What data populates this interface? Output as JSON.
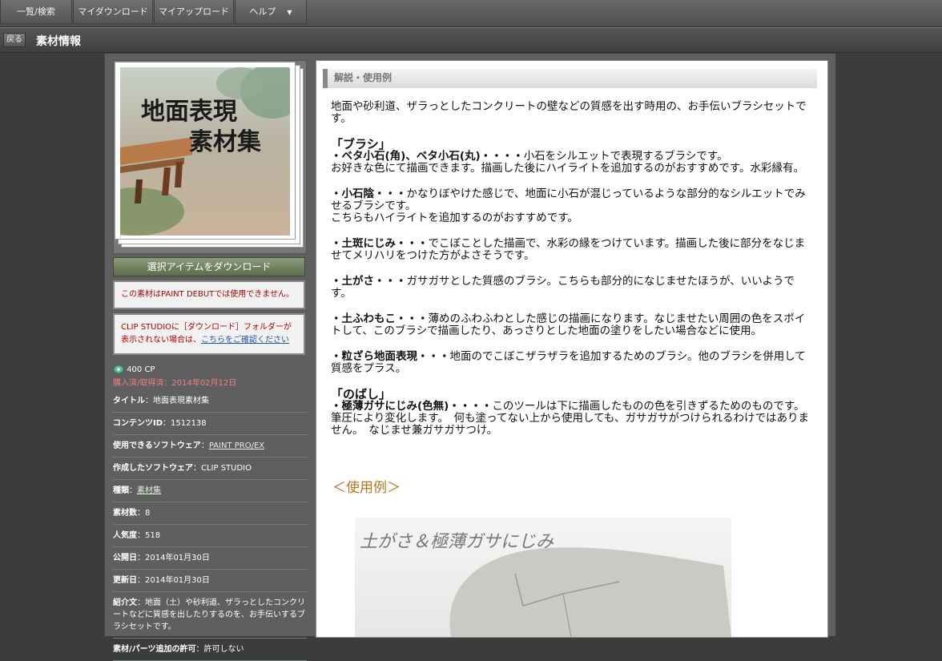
{
  "nav": {
    "tabs": [
      "一覧/検索",
      "マイダウンロード",
      "マイアップロード",
      "ヘルプ"
    ],
    "help_arrow": "▼"
  },
  "subbar": {
    "back_label": "戻る",
    "title": "素材情報"
  },
  "thumbnail": {
    "title_line1": "地面表現",
    "title_line2": "素材集"
  },
  "download_button": "選択アイテムをダウンロード",
  "notice1": "この素材はPAINT DEBUTでは使用できません。",
  "notice2": {
    "text": "CLIP STUDIOに［ダウンロード］フォルダーが表示されない場合は、",
    "link": "こちらをご確認ください"
  },
  "info": {
    "cp": "400 CP",
    "purchased": "購入済/取得済：2014年02月12日",
    "rows": [
      {
        "label": "タイトル",
        "value": "：地面表現素材集"
      },
      {
        "label": "コンテンツID",
        "value": "：1512138"
      },
      {
        "label": "使用できるソフトウェア",
        "value": "：",
        "link": "PAINT PRO/EX"
      },
      {
        "label": "作成したソフトウェア",
        "value": "：CLIP STUDIO"
      },
      {
        "label": "種類",
        "value": "：",
        "link": "素材集"
      },
      {
        "label": "素材数",
        "value": "：8"
      },
      {
        "label": "人気度",
        "value": "：518"
      },
      {
        "label": "公開日",
        "value": "：2014年01月30日"
      },
      {
        "label": "更新日",
        "value": "：2014年01月30日"
      },
      {
        "label": "紹介文",
        "value": "：地面（土）や砂利道、ザラっとしたコンクリートなどに質感を出したりするのを、お手伝いするブラシセットです。"
      },
      {
        "label": "素材/パーツ追加の許可",
        "value": "：許可しない"
      }
    ]
  },
  "section_heading": "解説・使用例",
  "description": {
    "intro": "地面や砂利道、ザラっとしたコンクリートの壁などの質感を出す時用の、お手伝いブラシセットです。",
    "brush_heading": "「ブラシ」",
    "items": [
      {
        "name": "・ベタ小石(角)、ベタ小石(丸)・・・・",
        "text": "小石をシルエットで表現するブラシです。",
        "extra": "お好きな色にて描画できます。描画した後にハイライトを追加するのがおすすめです。水彩縁有。"
      },
      {
        "name": "・小石陰・・・",
        "text": "かなりぼやけた感じで、地面に小石が混じっているような部分的なシルエットでみせるブラシです。",
        "extra": "こちらもハイライトを追加するのがおすすめです。"
      },
      {
        "name": "・土斑にじみ・・・",
        "text": "でこぼことした描画で、水彩の縁をつけています。描画した後に部分をなじませてメリハリをつけた方がよさそうです。",
        "extra": ""
      },
      {
        "name": "・土がさ・・・",
        "text": "ガサガサとした質感のブラシ。こちらも部分的になじませたほうが、いいようです。",
        "extra": ""
      },
      {
        "name": "・土ふわもこ・・・",
        "text": "薄めのふわふわとした感じの描画になります。なじませたい周囲の色をスポイトして、このブラシで描画したり、あっさりとした地面の塗りをしたい場合などに使用。",
        "extra": ""
      },
      {
        "name": "・粒ざら地面表現・・・",
        "text": "地面のでこぼこザラザラを追加するためのブラシ。他のブラシを併用して質感をプラス。",
        "extra": ""
      }
    ],
    "nobashi_heading": "「のばし」",
    "nobashi": {
      "name": "・極薄ガサにじみ(色無)・・・・",
      "text": "このツールは下に描画したものの色を引きずるためのものです。筆圧により変化します。　何も塗ってない上から使用しても、ガサガサがつけられるわけではありません。　なじませ兼ガサガサつけ。"
    }
  },
  "example_heading": "＜使用例＞",
  "example_image_text": "土がさ＆極薄ガサにじみ",
  "colors": {
    "accent_example": "#b8751a",
    "notice_red": "#b00000",
    "download_green": "#6a7b5a"
  }
}
